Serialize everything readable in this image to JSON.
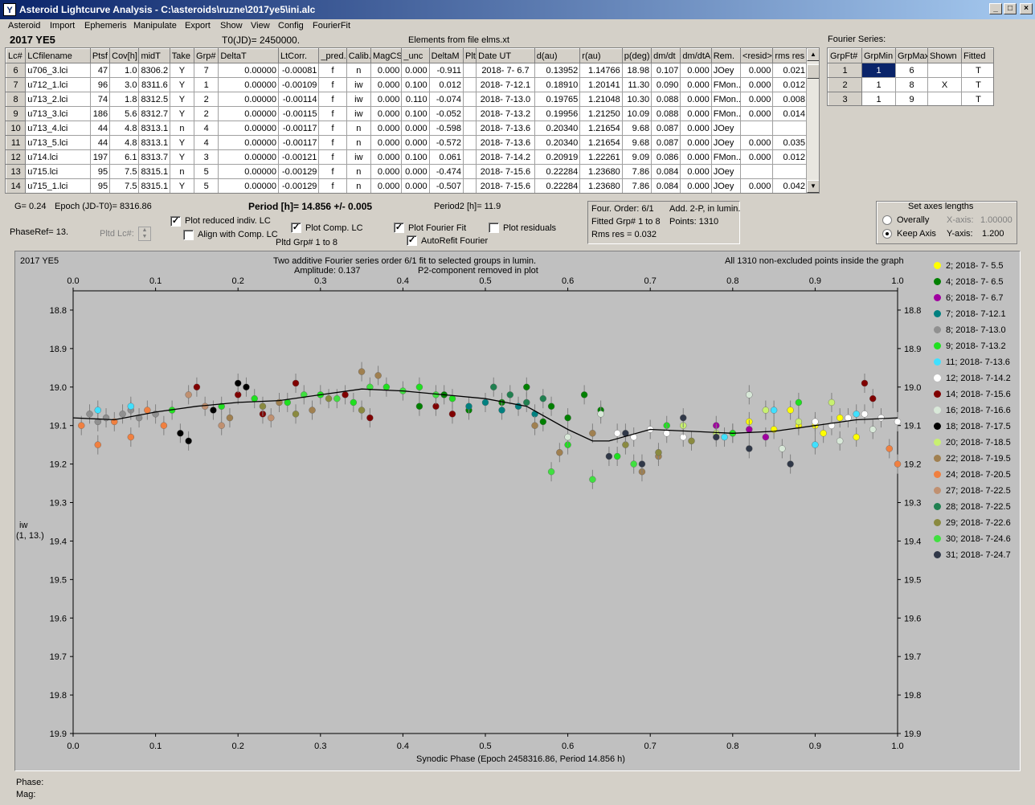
{
  "window": {
    "title": "Asteroid Lightcurve Analysis - C:\\asteroids\\ruzne\\2017ye5\\ini.alc",
    "icon": "app-icon",
    "btn_min": "_",
    "btn_max": "□",
    "btn_close": "×"
  },
  "menu": [
    "Asteroid",
    "Import",
    "Ephemeris",
    "Manipulate",
    "Export",
    "Show",
    "View",
    "Config",
    "FourierFit"
  ],
  "header": {
    "asteroid": "2017 YE5",
    "t0": "T0(JD)= 2450000.",
    "elements": "Elements from file elms.xt",
    "fourier_series": "Fourier Series:"
  },
  "lc_table": {
    "columns": [
      "Lc#",
      "LCfilename",
      "Ptsf",
      "Cov[h]",
      "midT",
      "Take",
      "Grp#",
      "DeltaT",
      "LtCorr.",
      "_pred.",
      "Calib.",
      "MagCS",
      "_unc",
      "DeltaM",
      "Plt",
      "Date UT",
      "d(au)",
      "r(au)",
      "p(deg)",
      "dm/dt",
      "dm/dtA",
      "Rem.",
      "<resid>",
      "rms res"
    ],
    "rows": [
      [
        "6",
        "u706_3.lci",
        "47",
        "1.0",
        "8306.2",
        "Y",
        "7",
        "0.00000",
        "-0.00081",
        "f",
        "n",
        "0.000",
        "0.000",
        "-0.911",
        "",
        "2018- 7- 6.7",
        "0.13952",
        "1.14766",
        "18.98",
        "0.107",
        "0.000",
        "JOey",
        "0.000",
        "0.021"
      ],
      [
        "7",
        "u712_1.lci",
        "96",
        "3.0",
        "8311.6",
        "Y",
        "1",
        "0.00000",
        "-0.00109",
        "f",
        "iw",
        "0.000",
        "0.100",
        "0.012",
        "",
        "2018- 7-12.1",
        "0.18910",
        "1.20141",
        "11.30",
        "0.090",
        "0.000",
        "FMon..",
        "0.000",
        "0.012"
      ],
      [
        "8",
        "u713_2.lci",
        "74",
        "1.8",
        "8312.5",
        "Y",
        "2",
        "0.00000",
        "-0.00114",
        "f",
        "iw",
        "0.000",
        "0.110",
        "-0.074",
        "",
        "2018- 7-13.0",
        "0.19765",
        "1.21048",
        "10.30",
        "0.088",
        "0.000",
        "FMon..",
        "0.000",
        "0.008"
      ],
      [
        "9",
        "u713_3.lci",
        "186",
        "5.6",
        "8312.7",
        "Y",
        "2",
        "0.00000",
        "-0.00115",
        "f",
        "iw",
        "0.000",
        "0.100",
        "-0.052",
        "",
        "2018- 7-13.2",
        "0.19956",
        "1.21250",
        "10.09",
        "0.088",
        "0.000",
        "FMon..",
        "0.000",
        "0.014"
      ],
      [
        "10",
        "u713_4.lci",
        "44",
        "4.8",
        "8313.1",
        "n",
        "4",
        "0.00000",
        "-0.00117",
        "f",
        "n",
        "0.000",
        "0.000",
        "-0.598",
        "",
        "2018- 7-13.6",
        "0.20340",
        "1.21654",
        "9.68",
        "0.087",
        "0.000",
        "JOey",
        "",
        ""
      ],
      [
        "11",
        "u713_5.lci",
        "44",
        "4.8",
        "8313.1",
        "Y",
        "4",
        "0.00000",
        "-0.00117",
        "f",
        "n",
        "0.000",
        "0.000",
        "-0.572",
        "",
        "2018- 7-13.6",
        "0.20340",
        "1.21654",
        "9.68",
        "0.087",
        "0.000",
        "JOey",
        "0.000",
        "0.035"
      ],
      [
        "12",
        "u714.lci",
        "197",
        "6.1",
        "8313.7",
        "Y",
        "3",
        "0.00000",
        "-0.00121",
        "f",
        "iw",
        "0.000",
        "0.100",
        "0.061",
        "",
        "2018- 7-14.2",
        "0.20919",
        "1.22261",
        "9.09",
        "0.086",
        "0.000",
        "FMon..",
        "0.000",
        "0.012"
      ],
      [
        "13",
        "u715.lci",
        "95",
        "7.5",
        "8315.1",
        "n",
        "5",
        "0.00000",
        "-0.00129",
        "f",
        "n",
        "0.000",
        "0.000",
        "-0.474",
        "",
        "2018- 7-15.6",
        "0.22284",
        "1.23680",
        "7.86",
        "0.084",
        "0.000",
        "JOey",
        "",
        ""
      ],
      [
        "14",
        "u715_1.lci",
        "95",
        "7.5",
        "8315.1",
        "Y",
        "5",
        "0.00000",
        "-0.00129",
        "f",
        "n",
        "0.000",
        "0.000",
        "-0.507",
        "",
        "2018- 7-15.6",
        "0.22284",
        "1.23680",
        "7.86",
        "0.084",
        "0.000",
        "JOey",
        "0.000",
        "0.042"
      ]
    ]
  },
  "fourier_table": {
    "columns": [
      "GrpFt#",
      "GrpMin",
      "GrpMax",
      "Shown",
      "Fitted"
    ],
    "rows": [
      [
        "1",
        "1",
        "6",
        "",
        "T"
      ],
      [
        "2",
        "1",
        "8",
        "X",
        "T"
      ],
      [
        "3",
        "1",
        "9",
        "",
        "T"
      ]
    ]
  },
  "controls": {
    "g": "G= 0.24",
    "epoch": "Epoch (JD-T0)= 8316.86",
    "phaseref": "PhaseRef= 13.",
    "pltd_lc": "Pltd Lc#:",
    "period": "Period [h]= 14.856 +/- 0.005",
    "period2": "Period2 [h]= 11.9",
    "plot_reduced": "Plot reduced indiv. LC",
    "align_comp": "Align with Comp. LC",
    "plot_comp": "Plot Comp. LC",
    "pltd_grp": "Pltd Grp#  1  to  8",
    "plot_fourier": "Plot Fourier Fit",
    "autorefit": "AutoRefit Fourier",
    "plot_residuals": "Plot residuals",
    "four_order": "Four. Order:  6/1",
    "add2p": "Add. 2-P, in lumin.",
    "fitted_grp": "Fitted Grp# 1 to 8",
    "points": "Points: 1310",
    "rms_res": "Rms res      = 0.032",
    "axes_title": "Set axes lengths",
    "overally": "Overally",
    "keep_axis": "Keep Axis",
    "x_axis_label": "X-axis:",
    "x_axis_val": "1.00000",
    "y_axis_label": "Y-axis:",
    "y_axis_val": "1.200"
  },
  "plot": {
    "name": "2017 YE5",
    "title1": "Two additive Fourier series order 6/1 fit to selected groups in lumin.",
    "title2a": "Amplitude: 0.137",
    "title2b": "P2-component removed in plot",
    "points_note": "All 1310 non-excluded points inside the graph",
    "xlabel": "Synodic Phase (Epoch 2458316.86, Period 14.856 h)",
    "ylabel1": "iw",
    "ylabel2": "(1, 13.)"
  },
  "chart_data": {
    "type": "scatter",
    "title": "Two additive Fourier series order 6/1 fit to selected groups in lumin.",
    "xlabel": "Synodic Phase (Epoch 2458316.86, Period 14.856 h)",
    "ylabel": "iw",
    "xlim": [
      0.0,
      1.0
    ],
    "ylim": [
      19.9,
      18.7
    ],
    "y_inverted": true,
    "xticks": [
      "0.0",
      "0.1",
      "0.2",
      "0.3",
      "0.4",
      "0.5",
      "0.6",
      "0.7",
      "0.8",
      "0.9",
      "1.0"
    ],
    "yticks": [
      "18.8",
      "18.9",
      "19.0",
      "19.1",
      "19.2",
      "19.3",
      "19.4",
      "19.5",
      "19.6",
      "19.7",
      "19.8",
      "19.9"
    ],
    "fourier_fit": {
      "x": [
        0.0,
        0.05,
        0.1,
        0.15,
        0.2,
        0.25,
        0.3,
        0.35,
        0.4,
        0.45,
        0.5,
        0.55,
        0.6,
        0.63,
        0.65,
        0.7,
        0.75,
        0.8,
        0.85,
        0.9,
        0.95,
        1.0
      ],
      "y": [
        19.08,
        19.085,
        19.065,
        19.05,
        19.04,
        19.035,
        19.02,
        19.005,
        19.01,
        19.02,
        19.03,
        19.05,
        19.11,
        19.14,
        19.14,
        19.11,
        19.115,
        19.12,
        19.115,
        19.1,
        19.085,
        19.08
      ]
    },
    "series": [
      {
        "name": "2; 2018- 7- 5.5",
        "color": "#ffff00",
        "x": [
          0.82,
          0.85,
          0.88,
          0.91,
          0.93,
          0.95,
          0.87,
          0.9
        ],
        "y": [
          19.09,
          19.11,
          19.1,
          19.12,
          19.08,
          19.13,
          19.06,
          19.1
        ]
      },
      {
        "name": "4; 2018- 7- 6.5",
        "color": "#008000",
        "x": [
          0.42,
          0.45,
          0.48,
          0.52,
          0.55,
          0.58,
          0.6,
          0.62,
          0.64,
          0.57
        ],
        "y": [
          19.05,
          19.02,
          19.06,
          19.04,
          19.0,
          19.05,
          19.08,
          19.02,
          19.06,
          19.09
        ]
      },
      {
        "name": "6; 2018- 7- 6.7",
        "color": "#a000a0",
        "x": [
          0.78,
          0.8,
          0.82,
          0.84
        ],
        "y": [
          19.1,
          19.12,
          19.11,
          19.13
        ]
      },
      {
        "name": "7; 2018- 7-12.1",
        "color": "#008080",
        "x": [
          0.5,
          0.52,
          0.54,
          0.56,
          0.48
        ],
        "y": [
          19.04,
          19.06,
          19.05,
          19.07,
          19.05
        ]
      },
      {
        "name": "8; 2018- 7-13.0",
        "color": "#909090",
        "x": [
          0.02,
          0.04,
          0.06,
          0.08,
          0.1,
          0.03,
          0.07
        ],
        "y": [
          19.07,
          19.08,
          19.07,
          19.08,
          19.07,
          19.09,
          19.06
        ]
      },
      {
        "name": "9; 2018- 7-13.2",
        "color": "#20e020",
        "x": [
          0.12,
          0.18,
          0.22,
          0.26,
          0.3,
          0.34,
          0.38,
          0.42,
          0.46,
          0.6,
          0.66,
          0.72,
          0.8,
          0.88
        ],
        "y": [
          19.06,
          19.05,
          19.03,
          19.04,
          19.02,
          19.04,
          19.0,
          19.0,
          19.03,
          19.15,
          19.18,
          19.1,
          19.12,
          19.04
        ]
      },
      {
        "name": "11; 2018- 7-13.6",
        "color": "#40e0ff",
        "x": [
          0.03,
          0.07,
          0.79,
          0.85,
          0.9,
          0.95
        ],
        "y": [
          19.06,
          19.05,
          19.13,
          19.06,
          19.15,
          19.07
        ]
      },
      {
        "name": "12; 2018- 7-14.2",
        "color": "#ffffff",
        "x": [
          0.66,
          0.68,
          0.7,
          0.72,
          0.74,
          0.9,
          0.92,
          0.94,
          0.96,
          0.98,
          1.0
        ],
        "y": [
          19.12,
          19.13,
          19.11,
          19.12,
          19.13,
          19.09,
          19.1,
          19.08,
          19.07,
          19.08,
          19.09
        ]
      },
      {
        "name": "14; 2018- 7-15.6",
        "color": "#800000",
        "x": [
          0.15,
          0.2,
          0.23,
          0.27,
          0.33,
          0.36,
          0.44,
          0.46,
          0.96,
          0.97
        ],
        "y": [
          19.0,
          19.02,
          19.07,
          18.99,
          19.02,
          19.08,
          19.05,
          19.07,
          18.99,
          19.03
        ]
      },
      {
        "name": "16; 2018- 7-16.6",
        "color": "#d8e8d8",
        "x": [
          0.6,
          0.64,
          0.82,
          0.86,
          0.93,
          0.97
        ],
        "y": [
          19.13,
          19.07,
          19.02,
          19.16,
          19.14,
          19.11
        ]
      },
      {
        "name": "18; 2018- 7-17.5",
        "color": "#000000",
        "x": [
          0.13,
          0.14,
          0.2,
          0.21,
          0.17
        ],
        "y": [
          19.12,
          19.14,
          18.99,
          19.0,
          19.06
        ]
      },
      {
        "name": "20; 2018- 7-18.5",
        "color": "#c8f070",
        "x": [
          0.74,
          0.78,
          0.84,
          0.88,
          0.92
        ],
        "y": [
          19.1,
          19.12,
          19.06,
          19.09,
          19.04
        ]
      },
      {
        "name": "22; 2018- 7-19.5",
        "color": "#a08050",
        "x": [
          0.19,
          0.25,
          0.29,
          0.35,
          0.37,
          0.56,
          0.59,
          0.63,
          0.69,
          0.71
        ],
        "y": [
          19.08,
          19.04,
          19.06,
          18.96,
          18.97,
          19.1,
          19.17,
          19.12,
          19.22,
          19.18
        ]
      },
      {
        "name": "24; 2018- 7-20.5",
        "color": "#f08040",
        "x": [
          0.01,
          0.03,
          0.05,
          0.07,
          0.09,
          0.11,
          0.99,
          1.0
        ],
        "y": [
          19.1,
          19.15,
          19.09,
          19.13,
          19.06,
          19.1,
          19.16,
          19.2
        ]
      },
      {
        "name": "27; 2018- 7-22.5",
        "color": "#c09070",
        "x": [
          0.14,
          0.16,
          0.18,
          0.24
        ],
        "y": [
          19.02,
          19.05,
          19.1,
          19.08
        ]
      },
      {
        "name": "28; 2018- 7-22.5",
        "color": "#208050",
        "x": [
          0.51,
          0.53,
          0.55,
          0.57
        ],
        "y": [
          19.0,
          19.02,
          19.04,
          19.03
        ]
      },
      {
        "name": "29; 2018- 7-22.6",
        "color": "#8a8a40",
        "x": [
          0.23,
          0.27,
          0.31,
          0.35,
          0.67,
          0.71,
          0.75
        ],
        "y": [
          19.05,
          19.07,
          19.03,
          19.06,
          19.15,
          19.17,
          19.14
        ]
      },
      {
        "name": "30; 2018- 7-24.6",
        "color": "#40e040",
        "x": [
          0.28,
          0.32,
          0.36,
          0.4,
          0.44,
          0.58,
          0.63,
          0.68
        ],
        "y": [
          19.02,
          19.03,
          19.0,
          19.01,
          19.02,
          19.22,
          19.24,
          19.2
        ]
      },
      {
        "name": "31; 2018- 7-24.7",
        "color": "#303848",
        "x": [
          0.65,
          0.67,
          0.69,
          0.74,
          0.78,
          0.82,
          0.87
        ],
        "y": [
          19.18,
          19.12,
          19.2,
          19.08,
          19.13,
          19.16,
          19.2
        ]
      }
    ]
  }
}
